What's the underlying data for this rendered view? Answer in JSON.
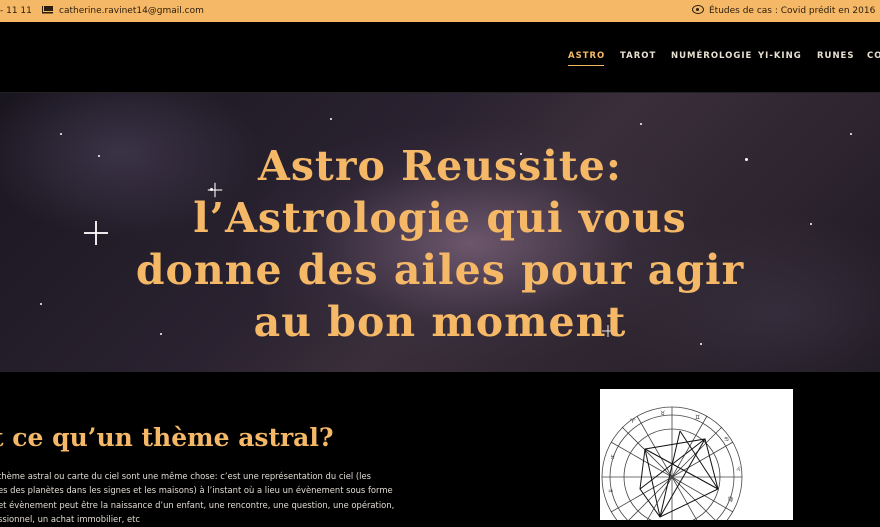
{
  "topbar": {
    "phone": "- 11 11",
    "email": "catherine.ravinet14@gmail.com",
    "study": "Études de cas : Covid prédit en 2016"
  },
  "nav": {
    "items": [
      {
        "label": "ASTRO",
        "active": true
      },
      {
        "label": "TAROT",
        "active": false
      },
      {
        "label": "NUMÉROLOGIE",
        "active": false
      },
      {
        "label": "YI-KING",
        "active": false
      },
      {
        "label": "RUNES",
        "active": false
      },
      {
        "label": "CO",
        "active": false
      }
    ]
  },
  "hero": {
    "title_lines": [
      "Astro Reussite:",
      "l’Astrologie qui vous",
      "donne des ailes pour agir",
      "au bon moment"
    ]
  },
  "content": {
    "section_title": "t ce qu’un thème astral?",
    "paragraph_lines": [
      "thème astral ou carte du ciel sont une même chose: c’est une représentation du ciel (les",
      "es des planètes dans les signes et les maisons) à l’instant où a lieu un évènement sous forme",
      "et évènement peut être la naissance d’un enfant, une rencontre, une question, une opération,",
      "ssionnel, un achat immobilier, etc"
    ]
  },
  "colors": {
    "accent": "#f5b867",
    "background": "#000000",
    "topbar_text": "#2a1d0c",
    "body_text": "#e0dbd2"
  },
  "icons": {
    "email": "envelope-icon",
    "study": "eye-icon"
  }
}
